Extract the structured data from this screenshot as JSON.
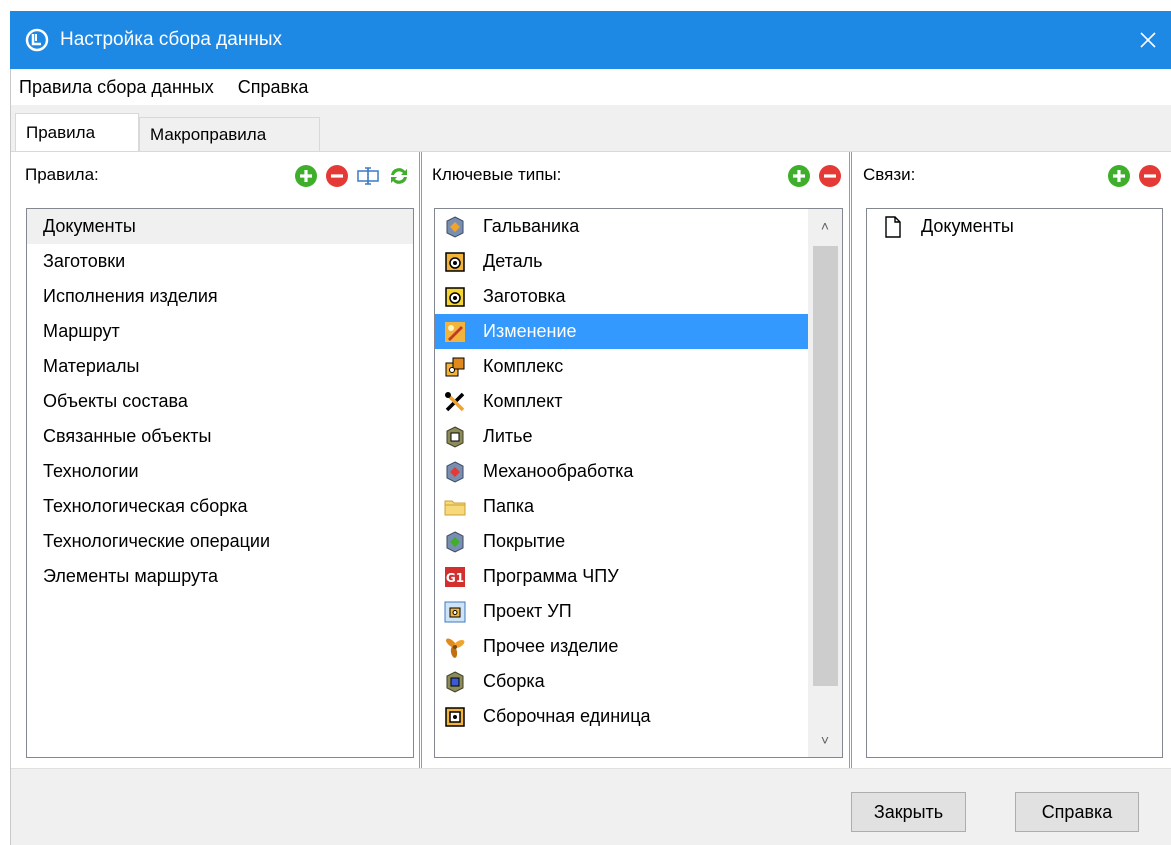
{
  "window": {
    "title": "Настройка сбора данных",
    "accent_color": "#1e88e5",
    "app_icon": "app-logo-icon",
    "close_icon": "close-icon"
  },
  "menu": [
    {
      "label": "Правила сбора данных"
    },
    {
      "label": "Справка"
    }
  ],
  "tabs": [
    {
      "label": "Правила",
      "active": true
    },
    {
      "label": "Макроправила",
      "active": false
    }
  ],
  "rules_panel": {
    "label": "Правила:",
    "tools": [
      "add-icon",
      "remove-icon",
      "rename-icon",
      "refresh-icon"
    ],
    "selected_index": 0,
    "items": [
      "Документы",
      "Заготовки",
      "Исполнения изделия",
      "Маршрут",
      "Материалы",
      "Объекты состава",
      "Связанные объекты",
      "Технологии",
      "Технологическая сборка",
      "Технологические операции",
      "Элементы маршрута"
    ]
  },
  "key_types_panel": {
    "label": "Ключевые типы:",
    "tools": [
      "add-icon",
      "remove-icon"
    ],
    "selected_index": 3,
    "items": [
      {
        "label": "Гальваника",
        "icon": "galvanic-icon"
      },
      {
        "label": "Деталь",
        "icon": "part-icon"
      },
      {
        "label": "Заготовка",
        "icon": "blank-icon"
      },
      {
        "label": "Изменение",
        "icon": "change-icon"
      },
      {
        "label": "Комплекс",
        "icon": "complex-icon"
      },
      {
        "label": "Комплект",
        "icon": "kit-icon"
      },
      {
        "label": "Литье",
        "icon": "casting-icon"
      },
      {
        "label": "Механообработка",
        "icon": "machining-icon"
      },
      {
        "label": "Папка",
        "icon": "folder-icon"
      },
      {
        "label": "Покрытие",
        "icon": "coating-icon"
      },
      {
        "label": "Программа ЧПУ",
        "icon": "cnc-program-icon"
      },
      {
        "label": "Проект УП",
        "icon": "cnc-project-icon"
      },
      {
        "label": "Прочее изделие",
        "icon": "other-product-icon"
      },
      {
        "label": "Сборка",
        "icon": "assembly-icon"
      },
      {
        "label": "Сборочная единица",
        "icon": "assembly-unit-icon"
      }
    ]
  },
  "links_panel": {
    "label": "Связи:",
    "tools": [
      "add-icon",
      "remove-icon"
    ],
    "items": [
      {
        "label": "Документы",
        "icon": "document-icon"
      }
    ]
  },
  "footer": {
    "close_label": "Закрыть",
    "help_label": "Справка"
  }
}
